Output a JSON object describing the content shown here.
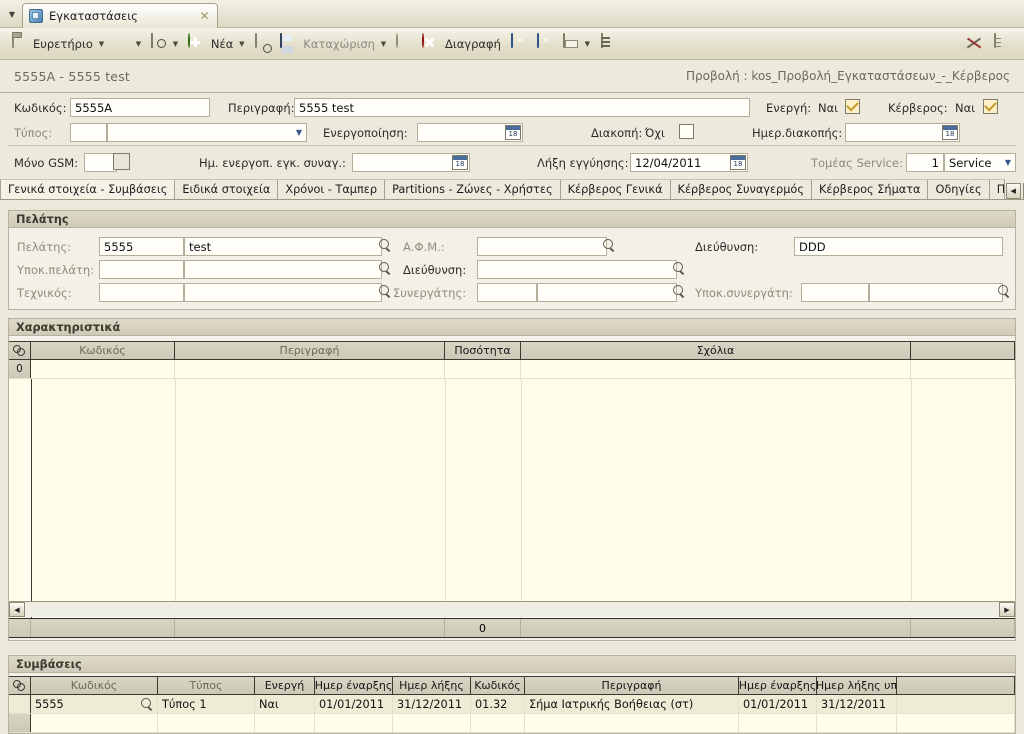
{
  "window": {
    "tab_label": "Εγκαταστάσεις",
    "tab_close": "✕",
    "tab_dropdown": "▼",
    "app_icon": "app-cube-icon"
  },
  "toolbar": {
    "items": [
      {
        "label": "Ευρετήριο",
        "icon": "clipboard-icon",
        "arrow": "▼",
        "dim": false
      },
      {
        "label": "",
        "icon": "star-icon",
        "arrow": "▼",
        "dim": false
      },
      {
        "label": "",
        "icon": "search-box-icon",
        "arrow": "▼",
        "dim": false
      },
      {
        "label": "Νέα",
        "icon": "new-plus-icon",
        "arrow": "▼",
        "dim": false
      },
      {
        "label": "",
        "icon": "copy-icon",
        "arrow": "",
        "dim": false
      },
      {
        "label": "Καταχώριση",
        "icon": "save-disk-icon",
        "arrow": "▼",
        "dim": true
      },
      {
        "label": "",
        "icon": "circle-icon",
        "arrow": "",
        "dim": false
      },
      {
        "label": "Διαγραφή",
        "icon": "delete-icon",
        "arrow": "",
        "dim": false
      },
      {
        "label": "",
        "icon": "nav-back-icon",
        "arrow": "",
        "dim": false
      },
      {
        "label": "",
        "icon": "nav-forward-icon",
        "arrow": "",
        "dim": false
      },
      {
        "label": "",
        "icon": "print-icon",
        "arrow": "▼",
        "dim": false
      },
      {
        "label": "",
        "icon": "report-icon",
        "arrow": "",
        "dim": false
      }
    ],
    "right_items": [
      {
        "icon": "tools-icon"
      },
      {
        "icon": "document-icon"
      }
    ]
  },
  "header": {
    "record_title": "5555A - 5555 test",
    "view_title": "Προβολή : kos_Προβολή_Εγκαταστάσεων_-_Κέρβερος"
  },
  "fields": {
    "kodikos_label": "Κωδικός:",
    "kodikos_value": "5555A",
    "perigrafi_label": "Περιγραφή:",
    "perigrafi_value": "5555 test",
    "energi_label": "Ενεργή:",
    "energi_value": "Ναι",
    "kerveros_label": "Κέρβερος:",
    "kerveros_value": "Ναι",
    "typos_label": "Τύπος:",
    "typos_value": "",
    "typos_desc": "",
    "energopoiisi_label": "Ενεργοποίηση:",
    "energopoiisi_value": "",
    "diakopi_label": "Διακοπή:",
    "diakopi_value": "Όχι",
    "imer_diakopis_label": "Ημερ.διακοπής:",
    "imer_diakopis_value": "",
    "mono_gsm_label": "Μόνο GSM:",
    "mono_gsm_value": "",
    "im_energop_label": "Ημ. ενεργοπ. εγκ. συναγ.:",
    "im_energop_value": "",
    "liksi_eggiisis_label": "Λήξη εγγύησης:",
    "liksi_eggiisis_value": "12/04/2011",
    "tomeas_service_label": "Τομέας Service:",
    "tomeas_service_num": "1",
    "tomeas_service_value": "Service"
  },
  "tabs": {
    "items": [
      {
        "label": "Γενικά στοιχεία - Συμβάσεις",
        "active": true
      },
      {
        "label": "Ειδικά στοιχεία",
        "active": false
      },
      {
        "label": "Χρόνοι - Ταμπερ",
        "active": false
      },
      {
        "label": "Partitions - Ζώνες - Χρήστες",
        "active": false
      },
      {
        "label": "Κέρβερος Γενικά",
        "active": false
      },
      {
        "label": "Κέρβερος Συναγερμός",
        "active": false
      },
      {
        "label": "Κέρβερος Σήματα",
        "active": false
      },
      {
        "label": "Οδηγίες",
        "active": false
      },
      {
        "label": "Παρατηρήσ",
        "active": false
      }
    ],
    "scroll_left": "◀",
    "scroll_right": "▶"
  },
  "pelatis_panel": {
    "title": "Πελάτης",
    "pelatis_label": "Πελάτης:",
    "pelatis_code": "5555",
    "pelatis_name": "test",
    "afm_label": "Α.Φ.Μ.:",
    "afm_value": "",
    "diefthinsi_right_label": "Διεύθυνση:",
    "diefthinsi_right_value": "DDD",
    "ypok_pelati_label": "Υποκ.πελάτη:",
    "ypok_pelati_code": "",
    "ypok_pelati_name": "",
    "diefthinsi_label": "Διεύθυνση:",
    "diefthinsi_value": "",
    "technikos_label": "Τεχνικός:",
    "technikos_code": "",
    "technikos_name": "",
    "synergatis_label": "Συνεργάτης:",
    "synergatis_code": "",
    "synergatis_name": "",
    "ypok_synergati_label": "Υποκ.συνεργάτη:",
    "ypok_synergati_code": "",
    "ypok_synergati_name": ""
  },
  "characteristics_panel": {
    "title": "Χαρακτηριστικά",
    "columns": [
      "",
      "Κωδικός",
      "Περιγραφή",
      "Ποσότητα",
      "Σχόλια",
      ""
    ],
    "rows": [
      {
        "num": "0",
        "kodikos": "",
        "perigrafi": "",
        "posotita": "",
        "sxolia": "",
        "extra": ""
      }
    ],
    "footer_total": "0",
    "scroll_left": "◀",
    "scroll_right": "▶"
  },
  "contracts_panel": {
    "title": "Συμβάσεις",
    "columns": [
      "",
      "Κωδικός",
      "Τύπος",
      "Ενεργή",
      "Ημερ έναρξης",
      "Ημερ λήξης",
      "Κωδικός",
      "Περιγραφή",
      "Ημερ έναρξης",
      "Ημερ λήξης υπ",
      ""
    ],
    "rows": [
      {
        "num": "",
        "kodikos": "5555",
        "typos": "Τύπος 1",
        "energi": "Ναι",
        "imer_enarksis": "01/01/2011",
        "imer_liksis": "31/12/2011",
        "kodikos2": "01.32",
        "perigrafi": "Σήμα Ιατρικής Βοήθειας (στ)",
        "imer_enarksis2": "01/01/2011",
        "imer_liksis_yp": "31/12/2011",
        "extra": ""
      },
      {
        "num": "",
        "kodikos": "",
        "typos": "",
        "energi": "",
        "imer_enarksis": "",
        "imer_liksis": "",
        "kodikos2": "",
        "perigrafi": "",
        "imer_enarksis2": "",
        "imer_liksis_yp": "",
        "extra": ""
      }
    ]
  },
  "colors": {
    "chrome": "#ece9dc",
    "toolbar": "#e2dec9",
    "panel": "#f3f1e7",
    "grid_row": "#fffdeb",
    "grid_header": "#d9d5c3",
    "accent_blue": "#3b6aa8",
    "danger_red": "#cf2222",
    "label_dim": "#8f8b78"
  }
}
